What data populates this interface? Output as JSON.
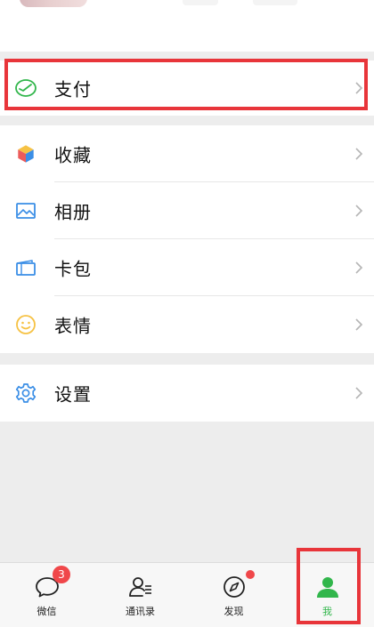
{
  "menu": {
    "pay": {
      "label": "支付",
      "icon": "wallet-icon"
    },
    "favorites": {
      "label": "收藏",
      "icon": "cube-icon"
    },
    "album": {
      "label": "相册",
      "icon": "image-icon"
    },
    "card": {
      "label": "卡包",
      "icon": "card-icon"
    },
    "stickers": {
      "label": "表情",
      "icon": "smile-icon"
    },
    "settings": {
      "label": "设置",
      "icon": "gear-icon"
    }
  },
  "tabbar": {
    "tabs": [
      {
        "label": "微信",
        "icon": "chat-icon",
        "badge": "3"
      },
      {
        "label": "通讯录",
        "icon": "contacts-icon"
      },
      {
        "label": "发现",
        "icon": "compass-icon"
      },
      {
        "label": "我",
        "icon": "person-icon"
      }
    ]
  },
  "colors": {
    "accent": "#31b64b",
    "highlight": "#e8353a",
    "badge": "#f0474a",
    "icon_blue": "#3a8ee6"
  }
}
